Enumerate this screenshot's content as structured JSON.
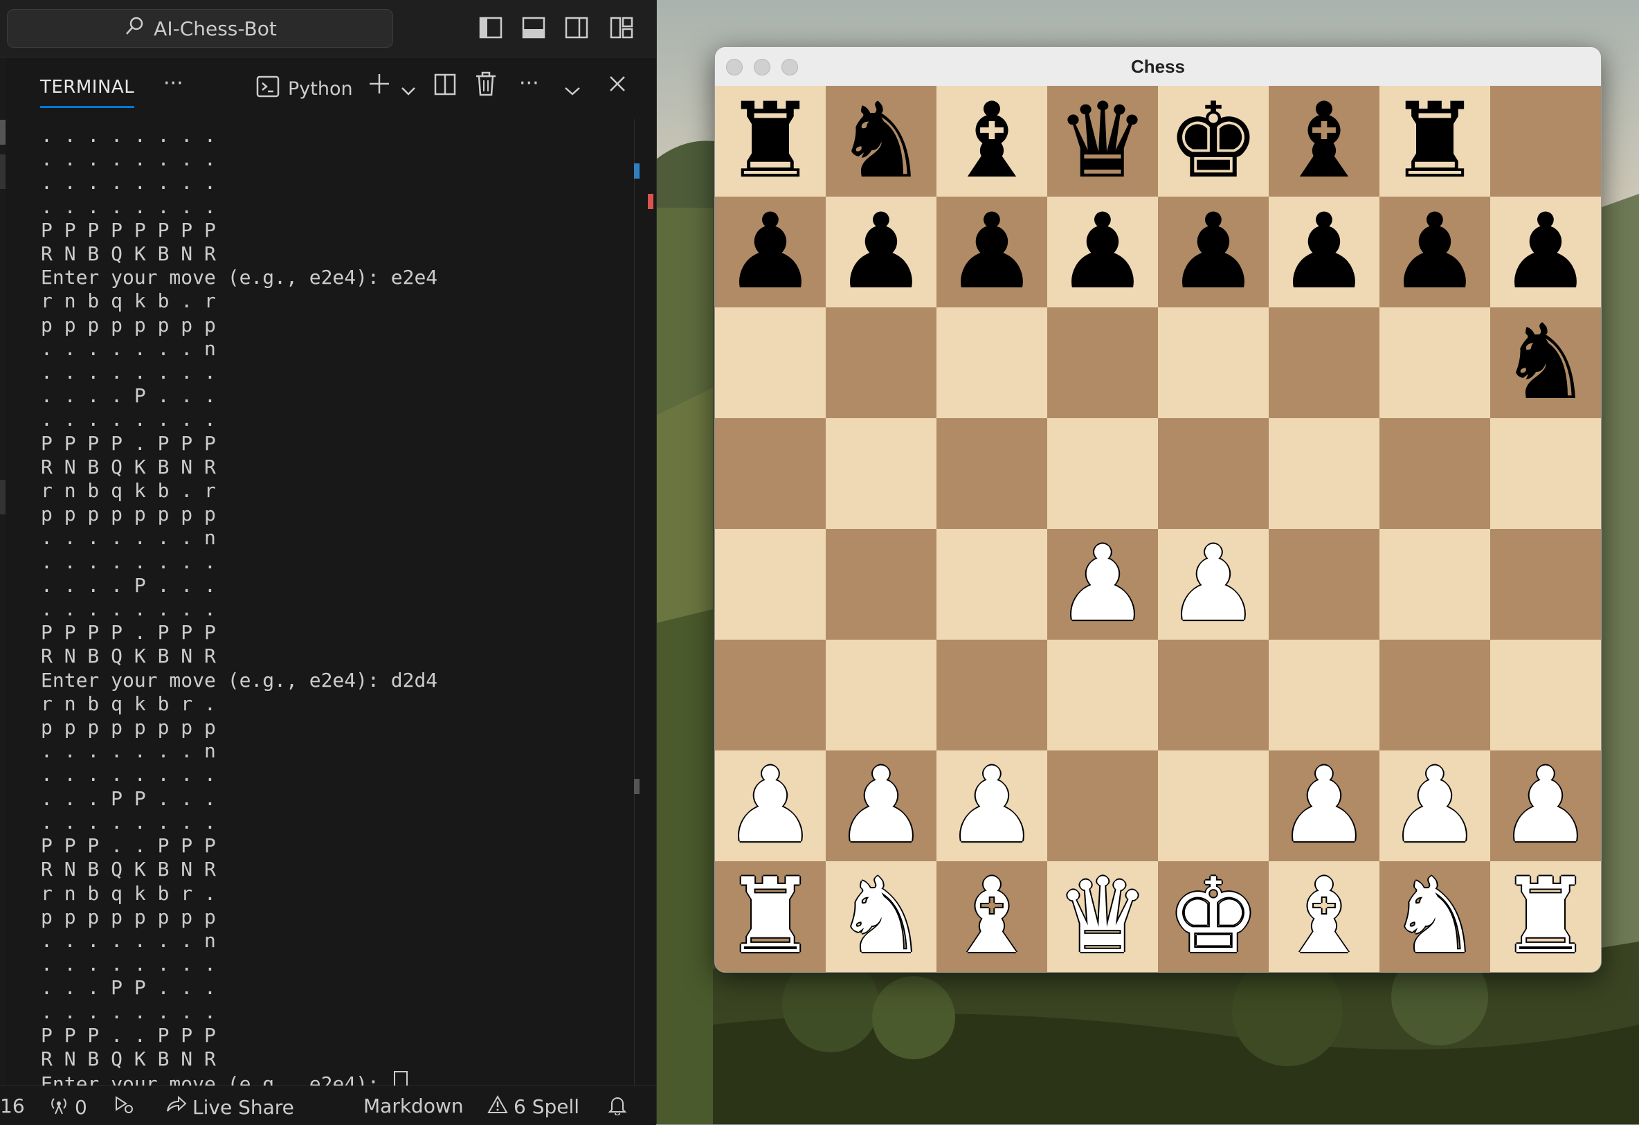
{
  "vscode": {
    "command_center": "AI-Chess-Bot",
    "panel_tab": "TERMINAL",
    "terminal_profile": "Python",
    "terminal_lines": [
      ". . . . . . . .",
      ". . . . . . . .",
      ". . . . . . . .",
      ". . . . . . . .",
      "P P P P P P P P",
      "R N B Q K B N R",
      "Enter your move (e.g., e2e4): e2e4",
      "r n b q k b . r",
      "p p p p p p p p",
      ". . . . . . . n",
      ". . . . . . . .",
      ". . . . P . . .",
      ". . . . . . . .",
      "P P P P . P P P",
      "R N B Q K B N R",
      "r n b q k b . r",
      "p p p p p p p p",
      ". . . . . . . n",
      ". . . . . . . .",
      ". . . . P . . .",
      ". . . . . . . .",
      "P P P P . P P P",
      "R N B Q K B N R",
      "Enter your move (e.g., e2e4): d2d4",
      "r n b q k b r .",
      "p p p p p p p p",
      ". . . . . . . n",
      ". . . . . . . .",
      ". . . P P . . .",
      ". . . . . . . .",
      "P P P . . P P P",
      "R N B Q K B N R",
      "r n b q k b r .",
      "p p p p p p p p",
      ". . . . . . . n",
      ". . . . . . . .",
      ". . . P P . . .",
      ". . . . . . . .",
      "P P P . . P P P",
      "R N B Q K B N R"
    ],
    "prompt_line": "Enter your move (e.g., e2e4): ",
    "status_bar": {
      "left_number": "16",
      "ports": "0",
      "live_share": "Live Share",
      "language": "Markdown",
      "spell": "6 Spell"
    },
    "icons": [
      "search-icon",
      "toggle-sidebar-icon",
      "toggle-panel-icon",
      "toggle-secondary-sidebar-icon",
      "customize-layout-icon",
      "terminal-icon",
      "plus-icon",
      "chevron-down-icon",
      "split-icon",
      "trash-icon",
      "more-icon",
      "close-icon",
      "broadcast-icon",
      "debug-icon",
      "live-share-icon",
      "warning-icon",
      "bell-icon"
    ],
    "colors": {
      "accent": "#0078d4",
      "panel_bg": "#181818",
      "text": "#cccccc"
    }
  },
  "chess": {
    "window_title": "Chess",
    "board": [
      [
        "r",
        "n",
        "b",
        "q",
        "k",
        "b",
        "r",
        ""
      ],
      [
        "p",
        "p",
        "p",
        "p",
        "p",
        "p",
        "p",
        "p"
      ],
      [
        "",
        "",
        "",
        "",
        "",
        "",
        "",
        "n"
      ],
      [
        "",
        "",
        "",
        "",
        "",
        "",
        "",
        ""
      ],
      [
        "",
        "",
        "",
        "P",
        "P",
        "",
        "",
        ""
      ],
      [
        "",
        "",
        "",
        "",
        "",
        "",
        "",
        ""
      ],
      [
        "P",
        "P",
        "P",
        "",
        "",
        "P",
        "P",
        "P"
      ],
      [
        "R",
        "N",
        "B",
        "Q",
        "K",
        "B",
        "N",
        "R"
      ]
    ],
    "glyphs": {
      "K": "♚",
      "Q": "♛",
      "R": "♜",
      "B": "♝",
      "N": "♞",
      "P": "♟",
      "k": "♚",
      "q": "♛",
      "r": "♜",
      "b": "♝",
      "n": "♞",
      "p": "♟"
    },
    "colors": {
      "light_square": "#efd9b5",
      "dark_square": "#b08b65"
    }
  }
}
